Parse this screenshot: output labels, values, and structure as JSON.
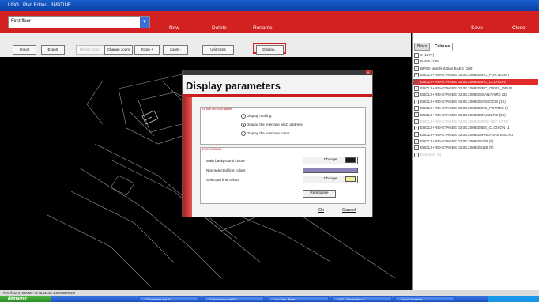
{
  "window": {
    "title": "LISO · Plan Editor · BMATIUE"
  },
  "topbar": {
    "floor_select_value": "First floor",
    "new_label": "New",
    "delete_label": "Delete",
    "rename_label": "Rename",
    "save_label": "Save",
    "close_label": "Close"
  },
  "toolbar": {
    "buttons": [
      "Import",
      "Export",
      "Revise zoom",
      "Change zoom",
      "Zoom +",
      "Zoom -",
      "Unit sizes",
      "Display..."
    ]
  },
  "sidepanel": {
    "tabs": [
      "Blocs",
      "Calques"
    ],
    "layers": [
      "0 (1277)",
      "BAES (108)",
      "BPSE-Numérotation BAES (100)",
      "EBOLS+REHETAGES 02.03.2008$0$PC_PORTESINT",
      "EBOLS+REHETAGES 02.03.2008$0$PC_CLOISON (",
      "EBOLS+REHETAGES 02.03.2008$0$PC_GROS_OEUV",
      "EBOLS+REHETAGES 02.03.2008$0$SANITAIRE (33",
      "EBOLS+REHETAGES 02.03.2008$0$ASSOCIE (12)",
      "EBOLS+REHETAGES 02.03.2008$0$PC_PORTES (2",
      "EBOLS+REHETAGES 02.03.2008$0$NUMERO (29)",
      "EBOLS+REHETAGES 02.03.2008$0$REF-REF EXTR",
      "EBOLS+REHETAGES 02.03.2008$0$ES_CLOISON (1",
      "EBOLS+REHETAGES 02.03.2008$0$PREFERE ESCALI",
      "EBOLS+REHETAGES 02.03.2008$0$126 (5)",
      "EBOLS+REHETAGES 02.03.2008$0$126 (5)",
      "Defpoints (0)"
    ],
    "selected_index": 4,
    "dim_indices": [
      10,
      15
    ]
  },
  "dialog": {
    "title": "Display parameters",
    "label_group_title": "Unit interface label",
    "radio_options": [
      "Display nothing",
      "Display the interface MAC address",
      "Display the interface name"
    ],
    "radio_selected": 1,
    "colours_group_title": "Line colours",
    "colour_rows": [
      {
        "label": "Main background colour",
        "button": "Change",
        "swatch": "#1a1a1a"
      },
      {
        "label": "Non-selected line colour",
        "button": "",
        "swatch": "#8a86b8"
      },
      {
        "label": "Selection line colour",
        "button": "Change",
        "swatch": "#ecec9a"
      }
    ],
    "reinit_label": "Reinitialise",
    "ok_label": "Ok",
    "cancel_label": "Cancel"
  },
  "statusbar": {
    "text": "First floor     X, 00MMI :   G:42,31L35 1.298,0079 2.0"
  },
  "taskbar": {
    "start_label": "démarrer",
    "tasks": [
      "3 Documents and Se...",
      "3 Documents and Se...",
      "Liso Map - Paint",
      "LISO - Designation of...",
      "Google Translate - ..."
    ]
  },
  "colors": {
    "accent_red": "#d32020",
    "title_blue": "#1a5fcf",
    "canvas": "#000000"
  }
}
